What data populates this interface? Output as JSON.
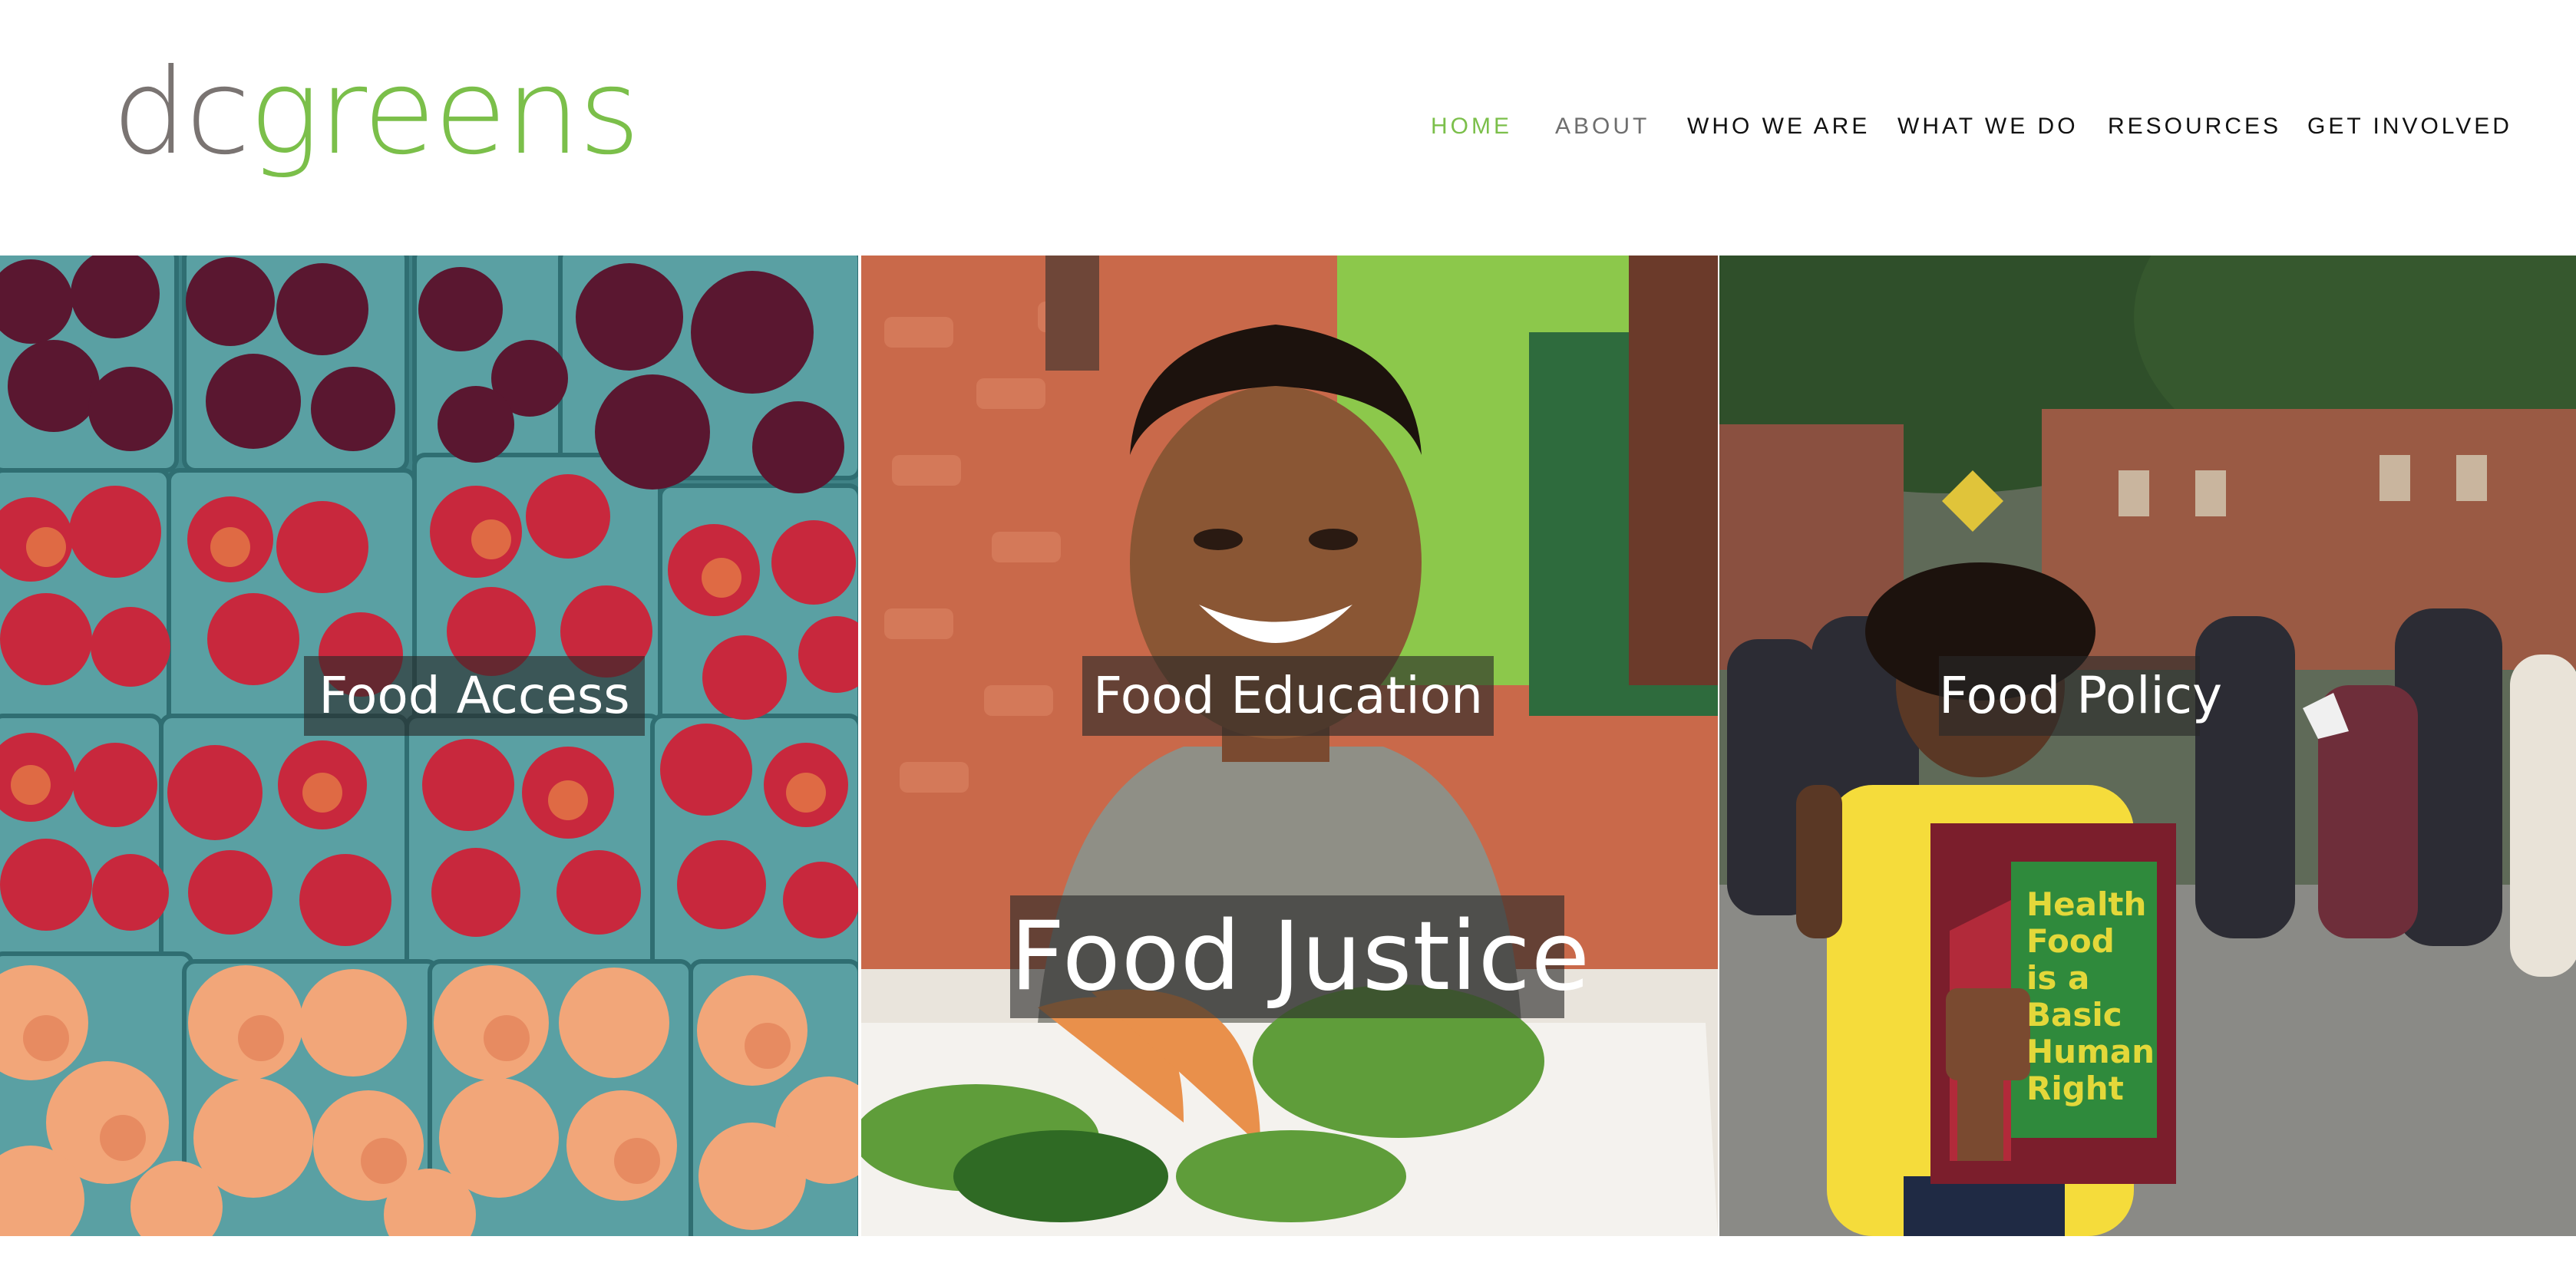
{
  "logo": {
    "dc": "dc",
    "greens": "greens"
  },
  "nav": {
    "home": "HOME",
    "about": "ABOUT",
    "who_we_are": "WHO WE ARE",
    "what_we_do": "WHAT WE DO",
    "resources": "RESOURCES",
    "get_involved": "GET INVOLVED"
  },
  "panels": {
    "access": "Food Access",
    "education": "Food Education",
    "policy": "Food Policy",
    "justice": "Food Justice"
  },
  "sign": {
    "line1": "Health",
    "line2": "Food",
    "line3": "is a",
    "line4": "Basic",
    "line5": "Human",
    "line6": "Right"
  },
  "colors": {
    "brand_green": "#7bbf4a",
    "brand_gray": "#7a7472",
    "label_bg": "rgba(40,40,40,0.62)"
  }
}
